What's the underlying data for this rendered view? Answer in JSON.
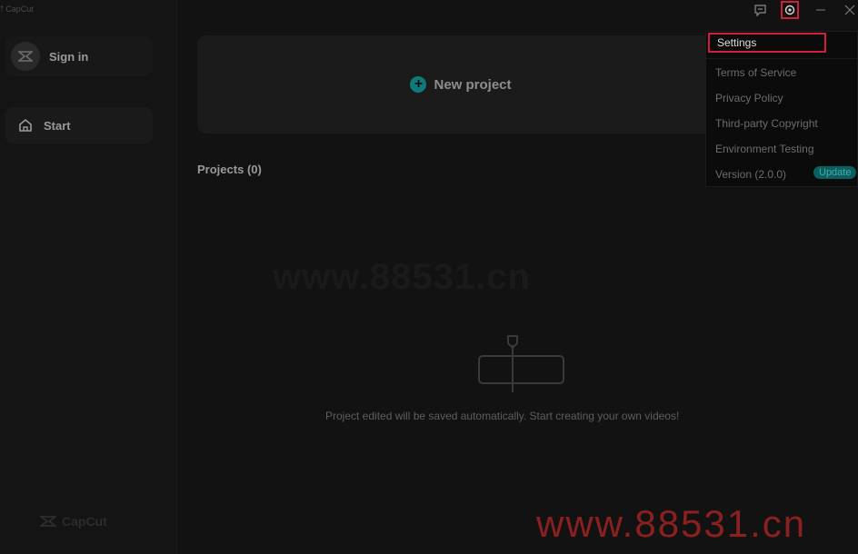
{
  "app": {
    "name": "CapCut"
  },
  "sidebar": {
    "sign_in_label": "Sign in",
    "nav_items": [
      {
        "label": "Start",
        "icon": "home-icon"
      }
    ],
    "footer_brand": "CapCut"
  },
  "main": {
    "new_project_label": "New project",
    "projects_heading": "Projects",
    "projects_count": "(0)",
    "empty_message": "Project edited will be saved automatically. Start creating your own videos!"
  },
  "titlebar": {
    "icons": [
      "feedback-icon",
      "settings-icon",
      "minimize-icon",
      "close-icon"
    ]
  },
  "settings_menu": {
    "items": [
      "Settings",
      "Terms of Service",
      "Privacy Policy",
      "Third-party Copyright",
      "Environment Testing",
      "Version (2.0.0)"
    ],
    "update_badge": "Update"
  },
  "watermarks": {
    "center": "www.88531.cn",
    "corner": "www.88531.cn"
  },
  "colors": {
    "background": "#121212",
    "accent": "#0e7a7a",
    "highlight": "#d01f3c",
    "watermark": "#8a2020"
  }
}
